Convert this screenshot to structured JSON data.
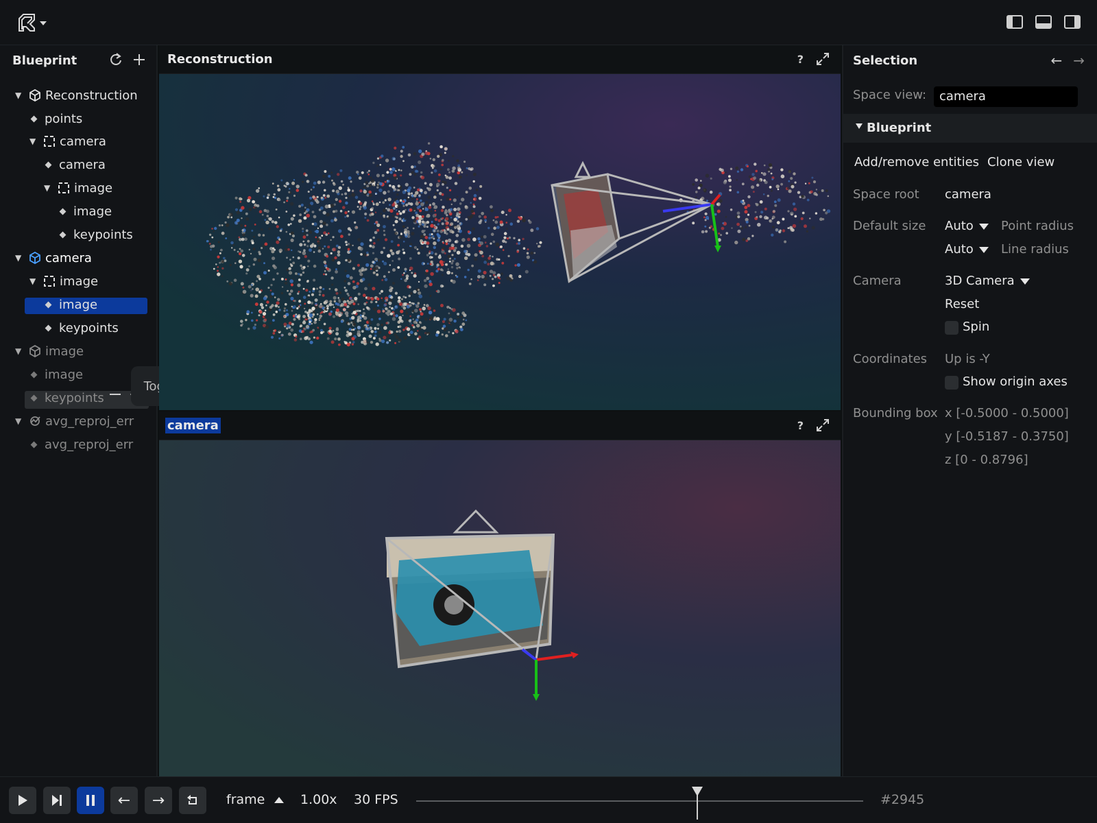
{
  "topbar": {
    "logo": "rerun-logo"
  },
  "blueprint": {
    "title": "Blueprint",
    "tree": [
      {
        "label": "Reconstruction",
        "kind": "space3d",
        "depth": 0,
        "expanded": true
      },
      {
        "label": "points",
        "kind": "entity",
        "depth": 1
      },
      {
        "label": "camera",
        "kind": "group",
        "depth": 1,
        "expanded": true
      },
      {
        "label": "camera",
        "kind": "entity",
        "depth": 2
      },
      {
        "label": "image",
        "kind": "group",
        "depth": 2,
        "expanded": true
      },
      {
        "label": "image",
        "kind": "entity",
        "depth": 3
      },
      {
        "label": "keypoints",
        "kind": "entity",
        "depth": 3
      },
      {
        "label": "camera",
        "kind": "space3d",
        "depth": 0,
        "expanded": true,
        "selected": true
      },
      {
        "label": "image",
        "kind": "group",
        "depth": 1,
        "expanded": true
      },
      {
        "label": "image",
        "kind": "entity",
        "depth": 2
      },
      {
        "label": "keypoints",
        "kind": "entity",
        "depth": 2
      },
      {
        "label": "image",
        "kind": "space3d",
        "depth": 0,
        "expanded": true,
        "hidden": true
      },
      {
        "label": "image",
        "kind": "entity",
        "depth": 1,
        "hidden": true
      },
      {
        "label": "keypoints",
        "kind": "entity",
        "depth": 1,
        "hidden": true
      },
      {
        "label": "avg_reproj_err",
        "kind": "timeseries",
        "depth": 0,
        "expanded": true,
        "hidden": true
      },
      {
        "label": "avg_reproj_err",
        "kind": "entity",
        "depth": 1,
        "hidden": true
      }
    ],
    "tooltip": "Toggle visibility"
  },
  "views": {
    "top": {
      "title": "Reconstruction",
      "help": "?"
    },
    "bottom": {
      "title": "camera",
      "help": "?"
    }
  },
  "selection": {
    "title": "Selection",
    "space_view_label": "Space view:",
    "space_view_value": "camera",
    "section": "Blueprint",
    "add_remove": "Add/remove entities",
    "clone": "Clone view",
    "space_root_label": "Space root",
    "space_root_value": "camera",
    "default_size_label": "Default size",
    "point_size": "Auto",
    "point_hint": "Point radius",
    "line_size": "Auto",
    "line_hint": "Line radius",
    "camera_label": "Camera",
    "camera_value": "3D Camera",
    "reset": "Reset",
    "spin": "Spin",
    "coordinates_label": "Coordinates",
    "coordinates_value": "Up is -Y",
    "origin_axes": "Show origin axes",
    "bbox_label": "Bounding box",
    "bbox_x": "x [-0.5000 - 0.5000]",
    "bbox_y": "y [-0.5187 - 0.3750]",
    "bbox_z": "z [0 - 0.8796]"
  },
  "timeline": {
    "timeline_name": "frame",
    "speed": "1.00x",
    "fps": "30 FPS",
    "frame": "#2945",
    "position": 0.658
  },
  "colors": {
    "accent": "#0c3a9c",
    "axis_x": "#e02020",
    "axis_y": "#18c018",
    "axis_z": "#3a3af0"
  }
}
